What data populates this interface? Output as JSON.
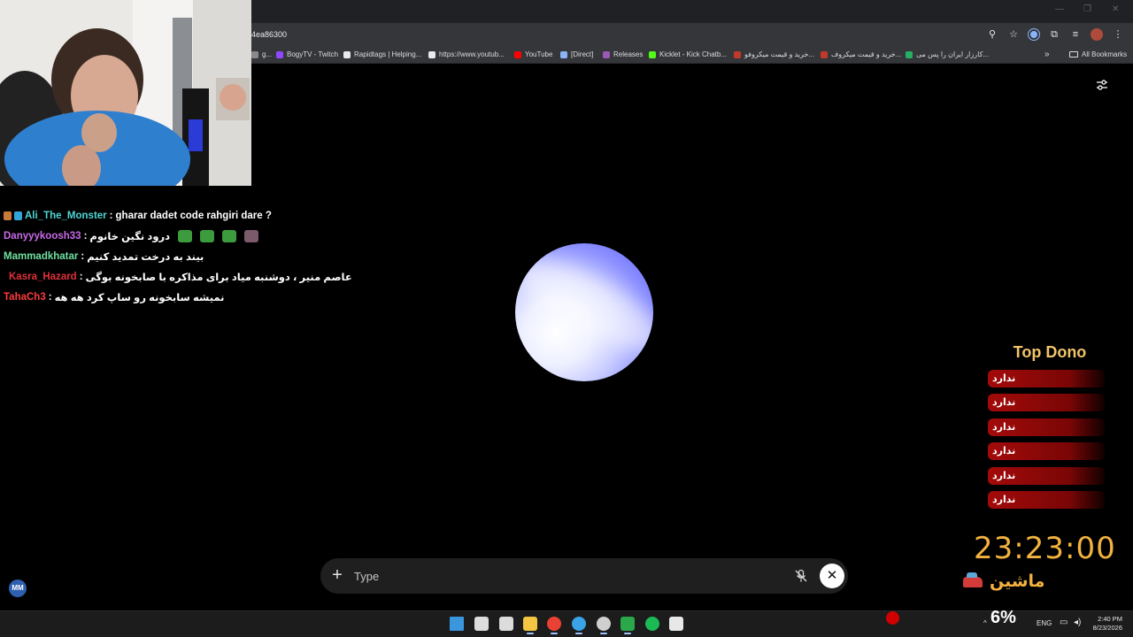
{
  "browser": {
    "url": "4ea86300",
    "bookmarks": [
      {
        "label": "g...",
        "color": "#8a8a8a"
      },
      {
        "label": "BogyTV - Twitch",
        "color": "#9146ff"
      },
      {
        "label": "Rapidtags | Helping...",
        "color": "#e8eaed"
      },
      {
        "label": "https://www.youtub...",
        "color": "#e8eaed"
      },
      {
        "label": "YouTube",
        "color": "#ff0000"
      },
      {
        "label": "[Direct]",
        "color": "#8ab4f8"
      },
      {
        "label": "Releases",
        "color": "#9b59b6"
      },
      {
        "label": "Kicklet - Kick Chatb...",
        "color": "#53fc18"
      },
      {
        "label": "خرید و قیمت میکروفو...",
        "color": "#c0392b"
      },
      {
        "label": "خرید و قیمت میکروف...",
        "color": "#c0392b"
      },
      {
        "label": "کارزار ایران را پس می...",
        "color": "#27ae60"
      }
    ],
    "all_bookmarks_label": "All Bookmarks"
  },
  "chat": [
    {
      "user": "Ali_The_Monster",
      "user_color": "#4fd6d6",
      "message": "gharar dadet code rahgiri dare ?",
      "badges": [
        "#c97a3b",
        "#33a3d9"
      ],
      "emotes": []
    },
    {
      "user": "Danyyykoosh33",
      "user_color": "#c86be8",
      "message": "درود نگین خانوم",
      "badges": [],
      "emotes": [
        "#3c9b3c",
        "#3c9b3c",
        "#3c9b3c",
        "#7a5a6b"
      ]
    },
    {
      "user": "Mammadkhatar",
      "user_color": "#6fe0a0",
      "message": "بیند به درخت تمدید کنیم",
      "badges": [],
      "emotes": []
    },
    {
      "user": "Kasra_Hazard",
      "user_color": "#e0303a",
      "message": "عاصم منیر ، دوشنبه میاد برای مذاکره با صابخونه بوگی",
      "badges": [
        "#f2c200",
        "#f2c200"
      ],
      "emotes": []
    },
    {
      "user": "TahaCh3",
      "user_color": "#ff3b3b",
      "message": "نمیشه سابخونه رو ساپ کرد هه هه",
      "badges": [],
      "emotes": []
    }
  ],
  "prompt": {
    "placeholder": "Type",
    "plus_label": "+",
    "close_label": "✕"
  },
  "top_dono": {
    "title": "Top Dono",
    "entries": [
      "ندارد",
      "ندارد",
      "ندارد",
      "ندارد",
      "ندارد",
      "ندارد"
    ]
  },
  "timer": {
    "value": "23:23:00",
    "label": "ماشین"
  },
  "overlay": {
    "avatar_initials": "MM",
    "percent": "6%"
  },
  "taskbar": {
    "apps": [
      {
        "name": "start-icon",
        "color": "#3a96dd"
      },
      {
        "name": "search-icon",
        "color": "#dcdcdc"
      },
      {
        "name": "task-view-icon",
        "color": "#dcdcdc"
      },
      {
        "name": "file-explorer-icon",
        "color": "#f4c542"
      },
      {
        "name": "chrome-icon",
        "color": "#e94235"
      },
      {
        "name": "vscode-icon",
        "color": "#3aa3e6"
      },
      {
        "name": "obs-icon",
        "color": "#cfcfcf"
      },
      {
        "name": "telegram-icon",
        "color": "#2aa84a"
      },
      {
        "name": "spotify-icon",
        "color": "#1db954"
      },
      {
        "name": "app-icon",
        "color": "#e8e8e8"
      }
    ],
    "language": "ENG",
    "time": "2:40 PM",
    "date": "8/23/2026"
  }
}
